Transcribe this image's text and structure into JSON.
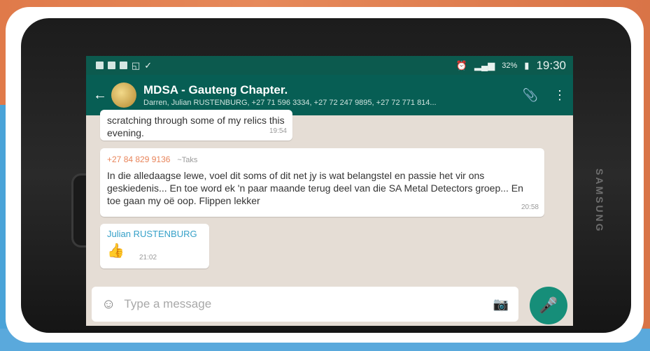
{
  "status_bar": {
    "battery": "32%",
    "time": "19:30"
  },
  "app_bar": {
    "group_title": "MDSA - Gauteng Chapter.",
    "members": "Darren, Julian RUSTENBURG, +27 71 596 3334, +27 72 247 9895, +27 72 771 814..."
  },
  "messages": [
    {
      "text": "scratching through some of my relics this evening.",
      "time": "19:54"
    },
    {
      "sender_phone": "+27 84 829 9136",
      "sender_alias": "~Taks",
      "text": "In die alledaagse lewe, voel dit soms of dit net jy is wat belangstel en passie het vir ons geskiedenis... En toe word ek 'n paar maande terug deel van die SA Metal Detectors groep... En toe gaan my oë oop. Flippen lekker",
      "time": "20:58"
    },
    {
      "sender_name": "Julian RUSTENBURG",
      "emoji": "👍",
      "time": "21:02"
    }
  ],
  "input": {
    "placeholder": "Type a message"
  },
  "device": {
    "brand": "SAMSUNG"
  },
  "icons": {
    "back": "arrow-left-icon",
    "attach": "paperclip-icon",
    "menu": "more-vertical-icon",
    "emoji": "emoji-icon",
    "camera": "camera-icon",
    "mic": "microphone-icon"
  },
  "colors": {
    "header": "#075e54",
    "accent": "#168e79",
    "chat_bg": "#e5ddd5"
  }
}
